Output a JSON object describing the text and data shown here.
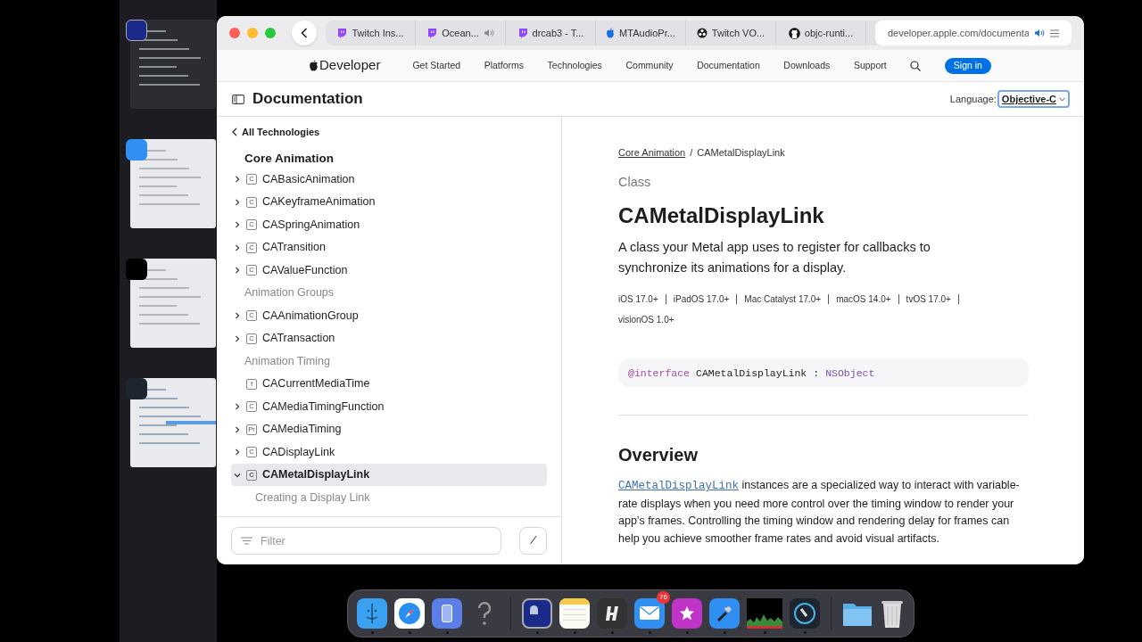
{
  "browser": {
    "tabs": [
      {
        "kind": "twitch",
        "title": "Twitch Ins...",
        "audio": false,
        "selected": false
      },
      {
        "kind": "twitch",
        "title": "Ocean...",
        "audio": true,
        "selected": false
      },
      {
        "kind": "twitch",
        "title": "drcab3 - T...",
        "audio": false,
        "selected": false
      },
      {
        "kind": "apple",
        "title": "MTAudioPr...",
        "audio": false,
        "selected": false
      },
      {
        "kind": "obs",
        "title": "Twitch VO...",
        "audio": false,
        "selected": false
      },
      {
        "kind": "github",
        "title": "objc-runti...",
        "audio": false,
        "selected": false
      },
      {
        "kind": "address",
        "title": "developer.apple.com/documenta",
        "audio": true,
        "selected": true
      }
    ]
  },
  "nav": {
    "brand": "Developer",
    "links": [
      "Get Started",
      "Platforms",
      "Technologies",
      "Community",
      "Documentation",
      "Downloads",
      "Support"
    ],
    "sign_in": "Sign in"
  },
  "doc_header": {
    "title": "Documentation",
    "language_label": "Language:",
    "language": "Objective-C"
  },
  "sidebar": {
    "back": "All Technologies",
    "title": "Core Animation",
    "items": [
      {
        "kind": "symbol",
        "badge": "C",
        "label": "CABasicAnimation",
        "expanded": false,
        "selected": false
      },
      {
        "kind": "symbol",
        "badge": "C",
        "label": "CAKeyframeAnimation",
        "expanded": false,
        "selected": false
      },
      {
        "kind": "symbol",
        "badge": "C",
        "label": "CASpringAnimation",
        "expanded": false,
        "selected": false
      },
      {
        "kind": "symbol",
        "badge": "C",
        "label": "CATransition",
        "expanded": false,
        "selected": false
      },
      {
        "kind": "symbol",
        "badge": "C",
        "label": "CAValueFunction",
        "expanded": false,
        "selected": false
      },
      {
        "kind": "heading",
        "label": "Animation Groups"
      },
      {
        "kind": "symbol",
        "badge": "C",
        "label": "CAAnimationGroup",
        "expanded": false,
        "selected": false
      },
      {
        "kind": "symbol",
        "badge": "C",
        "label": "CATransaction",
        "expanded": false,
        "selected": false
      },
      {
        "kind": "heading",
        "label": "Animation Timing"
      },
      {
        "kind": "function",
        "badge": "f",
        "label": "CACurrentMediaTime",
        "selected": false
      },
      {
        "kind": "symbol",
        "badge": "C",
        "label": "CAMediaTimingFunction",
        "expanded": false,
        "selected": false
      },
      {
        "kind": "symbol",
        "badge": "Pr",
        "label": "CAMediaTiming",
        "expanded": false,
        "selected": false
      },
      {
        "kind": "symbol",
        "badge": "C",
        "label": "CADisplayLink",
        "expanded": false,
        "selected": false
      },
      {
        "kind": "symbol",
        "badge": "C",
        "label": "CAMetalDisplayLink",
        "expanded": true,
        "selected": true,
        "children": [
          {
            "kind": "topic",
            "label": "Creating a Display Link"
          }
        ]
      }
    ],
    "filter_placeholder": "Filter",
    "shortcut": "/"
  },
  "article": {
    "breadcrumb_separator": "/",
    "breadcrumb": [
      {
        "label": "Core Animation",
        "link": true
      },
      {
        "label": "CAMetalDisplayLink",
        "link": false
      }
    ],
    "eyebrow": "Class",
    "title": "CAMetalDisplayLink",
    "abstract": "A class your Metal app uses to register for callbacks to synchronize its animations for a display.",
    "platforms": [
      "iOS 17.0+",
      "iPadOS 17.0+",
      "Mac Catalyst 17.0+",
      "macOS 14.0+",
      "tvOS 17.0+",
      "visionOS 1.0+"
    ],
    "declaration": [
      {
        "kind": "keyword",
        "text": "@interface"
      },
      {
        "kind": "plain",
        "text": "CAMetalDisplayLink"
      },
      {
        "kind": "plain",
        "text": ":"
      },
      {
        "kind": "type",
        "text": "NSObject"
      }
    ],
    "overview_title": "Overview",
    "overview_link": "CAMetalDisplayLink",
    "overview_text": " instances are a specialized way to interact with variable-rate displays when you need more control over the timing window to render your app’s frames. Controlling the timing window and rendering delay for frames can help you achieve smoother frame rates and avoid visual artifacts."
  },
  "dock": {
    "apps": [
      {
        "kind": "finder",
        "running": true
      },
      {
        "kind": "safari",
        "running": true
      },
      {
        "kind": "simulator",
        "running": true
      },
      {
        "kind": "unknown",
        "running": false
      },
      {
        "kind": "divider"
      },
      {
        "kind": "terminal",
        "running": true
      },
      {
        "kind": "notes",
        "running": true
      },
      {
        "kind": "hopper",
        "running": true
      },
      {
        "kind": "mail",
        "running": true,
        "badge": "76"
      },
      {
        "kind": "star",
        "running": true
      },
      {
        "kind": "xcode",
        "running": true
      },
      {
        "kind": "activity",
        "running": true
      },
      {
        "kind": "instruments",
        "running": true
      },
      {
        "kind": "divider"
      },
      {
        "kind": "folder",
        "running": false
      },
      {
        "kind": "trash",
        "running": false
      }
    ]
  }
}
